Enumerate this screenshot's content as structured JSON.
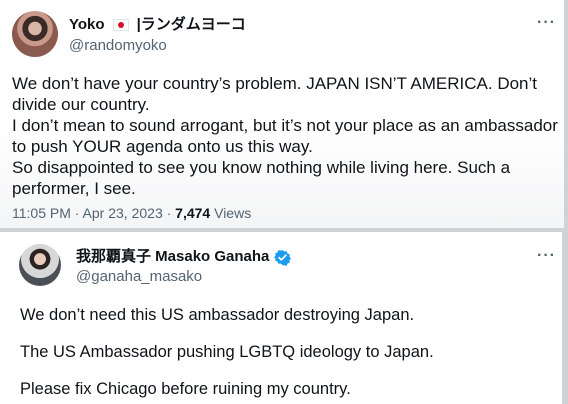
{
  "tweet1": {
    "display_name": "Yoko",
    "name_suffix": "|ランダムヨーコ",
    "handle": "@randomyoko",
    "lines": [
      "We don’t have your country’s problem. JAPAN ISN’T AMERICA. Don’t",
      "divide our country.",
      "I don’t mean to sound arrogant, but it’s not your place as an ambassador",
      "to push YOUR agenda onto us this way.",
      "So disappointed to see you know nothing while living here. Such a",
      "performer, I see."
    ],
    "timestamp": "11:05 PM · Apr 23, 2023 · ",
    "views_count": "7,474",
    "views_label": " Views",
    "more": "···"
  },
  "tweet2": {
    "display_name": "我那覇真子 Masako Ganaha",
    "handle": "@ganaha_masako",
    "paragraphs": [
      "We don’t need this US ambassador destroying Japan.",
      "The US Ambassador pushing LGBTQ ideology to Japan.",
      "Please fix Chicago before ruining my country."
    ],
    "more": "···"
  },
  "colors": {
    "text": "#0f1419",
    "secondary": "#536471",
    "verified": "#1d9bf0",
    "flag_red": "#d3112b"
  }
}
